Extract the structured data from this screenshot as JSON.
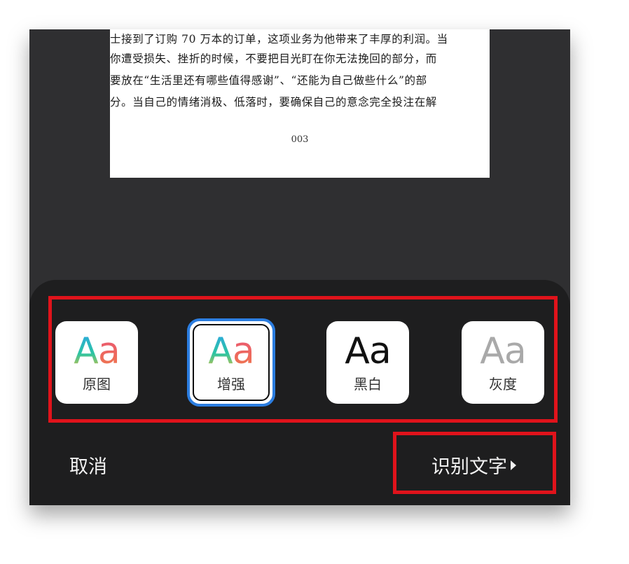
{
  "document": {
    "lines": [
      "士接到了订购 70 万本的订单，这项业务为他带来了丰厚的利润。当",
      "你遭受损失、挫折的时候，不要把目光盯在你无法挽回的部分，而",
      "要放在“生活里还有哪些值得感谢”、“还能为自己做些什么”的部",
      "分。当自己的情绪消极、低落时，要确保自己的意念完全投注在解"
    ],
    "page_number": "003"
  },
  "filters": [
    {
      "aa": "Aa",
      "label": "原图",
      "icon": "aa-color-icon",
      "selected": false
    },
    {
      "aa": "Aa",
      "label": "增强",
      "icon": "aa-color-icon",
      "selected": true
    },
    {
      "aa": "Aa",
      "label": "黑白",
      "icon": "aa-black-icon",
      "selected": false
    },
    {
      "aa": "Aa",
      "label": "灰度",
      "icon": "aa-gray-icon",
      "selected": false
    }
  ],
  "actions": {
    "cancel": "取消",
    "recognize": "识别文字",
    "recognize_icon": "triangle-right-icon"
  },
  "colors": {
    "annotation_red": "#e0131b",
    "selected_blue": "#2b7de0",
    "panel_bg": "#1e1e1f",
    "screen_bg": "#2f2f31"
  }
}
